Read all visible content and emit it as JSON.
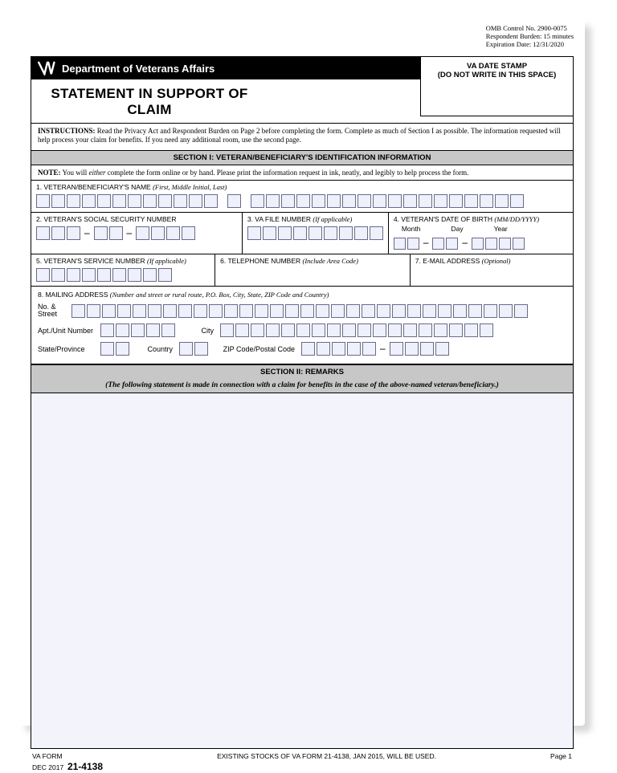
{
  "meta": {
    "omb": "OMB Control No. 2900-0075",
    "burden": "Respondent Burden: 15 minutes",
    "expire": "Expiration Date: 12/31/2020"
  },
  "header": {
    "dept": "Department of Veterans Affairs",
    "stamp1": "VA DATE STAMP",
    "stamp2": "(DO NOT WRITE IN THIS SPACE)",
    "title": "STATEMENT IN SUPPORT OF CLAIM"
  },
  "instructions": {
    "lead": "INSTRUCTIONS:",
    "body": "Read the Privacy Act and Respondent Burden on Page 2 before completing the form.  Complete as much of Section I as possible.  The information requested will help process your claim for benefits.  If you need any additional room, use the second page."
  },
  "section1": {
    "title": "SECTION I:  VETERAN/BENEFICIARY'S IDENTIFICATION INFORMATION",
    "note_lead": "NOTE:",
    "note_a": "You will ",
    "note_i": "either",
    "note_b": " complete the form online or by hand.  Please print the information request in ink, neatly, and legibly to help process the form.",
    "f1": "1. VETERAN/BENEFICIARY'S NAME ",
    "f1_i": "(First, Middle Initial, Last)",
    "f2": "2. VETERAN'S SOCIAL SECURITY NUMBER",
    "f3": "3. VA FILE NUMBER ",
    "f3_i": "(If applicable)",
    "f4": "4. VETERAN'S DATE OF BIRTH ",
    "f4_i": "(MM/DD/YYYY)",
    "dob": {
      "m": "Month",
      "d": "Day",
      "y": "Year"
    },
    "f5": "5. VETERAN'S SERVICE NUMBER ",
    "f5_i": "(If applicable)",
    "f6": "6. TELEPHONE NUMBER ",
    "f6_i": "(Include Area Code)",
    "f7": "7. E-MAIL ADDRESS ",
    "f7_i": "(Optional)",
    "f8": "8. MAILING ADDRESS ",
    "f8_i": "(Number and street or rural route, P.O. Box, City, State, ZIP Code and Country)",
    "addr": {
      "no_street": "No. & Street",
      "apt": "Apt./Unit Number",
      "city": "City",
      "state": "State/Province",
      "country": "Country",
      "zip": "ZIP Code/Postal Code"
    }
  },
  "section2": {
    "title": "SECTION II:  REMARKS",
    "sub": "(The following statement is made in connection with a claim for benefits in the case of the above-named veteran/beneficiary.)"
  },
  "footer": {
    "form_line1": "VA FORM",
    "form_line2": "DEC 2017",
    "form_no": "21-4138",
    "stock": "EXISTING STOCKS OF VA FORM 21-4138, JAN 2015, WILL BE USED.",
    "page": "Page 1"
  }
}
